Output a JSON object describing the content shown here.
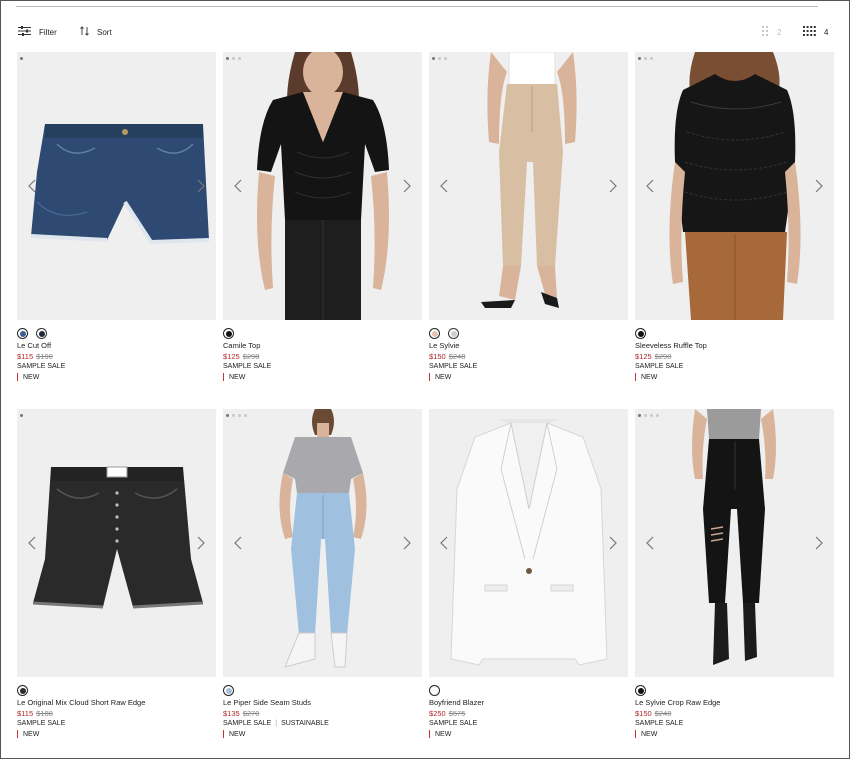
{
  "toolbar": {
    "filter_label": "Filter",
    "sort_label": "Sort",
    "grid2_label": "2",
    "grid4_label": "4"
  },
  "products": [
    {
      "name": "Le Cut Off",
      "sale_price": "$115",
      "orig_price": "$190",
      "tags": [
        "SAMPLE SALE"
      ],
      "badge": "NEW",
      "image": "denim-cutoff-shorts",
      "dots": 1,
      "swatches": [
        "#3b5f93",
        "#1f2a3c"
      ]
    },
    {
      "name": "Camile Top",
      "sale_price": "$125",
      "orig_price": "$298",
      "tags": [
        "SAMPLE SALE"
      ],
      "badge": "NEW",
      "image": "black-satin-top-model",
      "dots": 3,
      "swatches": [
        "#111111"
      ]
    },
    {
      "name": "Le Sylvie",
      "sale_price": "$150",
      "orig_price": "$248",
      "tags": [
        "SAMPLE SALE"
      ],
      "badge": "NEW",
      "image": "beige-jeans-model",
      "dots": 3,
      "swatches": [
        "#e5c2b3",
        "#cfcfcf"
      ]
    },
    {
      "name": "Sleeveless Ruffle Top",
      "sale_price": "$125",
      "orig_price": "$298",
      "tags": [
        "SAMPLE SALE"
      ],
      "badge": "NEW",
      "image": "black-lace-top-model",
      "dots": 3,
      "swatches": [
        "#111111"
      ]
    },
    {
      "name": "Le Original Mix Cloud Short Raw Edge",
      "sale_price": "$115",
      "orig_price": "$188",
      "tags": [
        "SAMPLE SALE"
      ],
      "badge": "NEW",
      "image": "black-denim-shorts",
      "dots": 1,
      "swatches": [
        "#2b2b2b"
      ]
    },
    {
      "name": "Le Piper Side Seam Studs",
      "sale_price": "$135",
      "orig_price": "$270",
      "tags": [
        "SAMPLE SALE",
        "SUSTAINABLE"
      ],
      "badge": "NEW",
      "image": "light-jeans-model",
      "dots": 4,
      "swatches": [
        "#a7bfd9"
      ]
    },
    {
      "name": "Boyfriend Blazer",
      "sale_price": "$250",
      "orig_price": "$575",
      "tags": [
        "SAMPLE SALE"
      ],
      "badge": "NEW",
      "image": "white-blazer",
      "dots": 0,
      "swatches": [
        "#ffffff"
      ]
    },
    {
      "name": "Le Sylvie Crop Raw Edge",
      "sale_price": "$150",
      "orig_price": "$248",
      "tags": [
        "SAMPLE SALE"
      ],
      "badge": "NEW",
      "image": "black-jeans-model",
      "dots": 4,
      "swatches": [
        "#111111"
      ]
    }
  ],
  "colors": {
    "sale_price": "#b0262a",
    "image_bg": "#efefef",
    "text": "#222222"
  }
}
